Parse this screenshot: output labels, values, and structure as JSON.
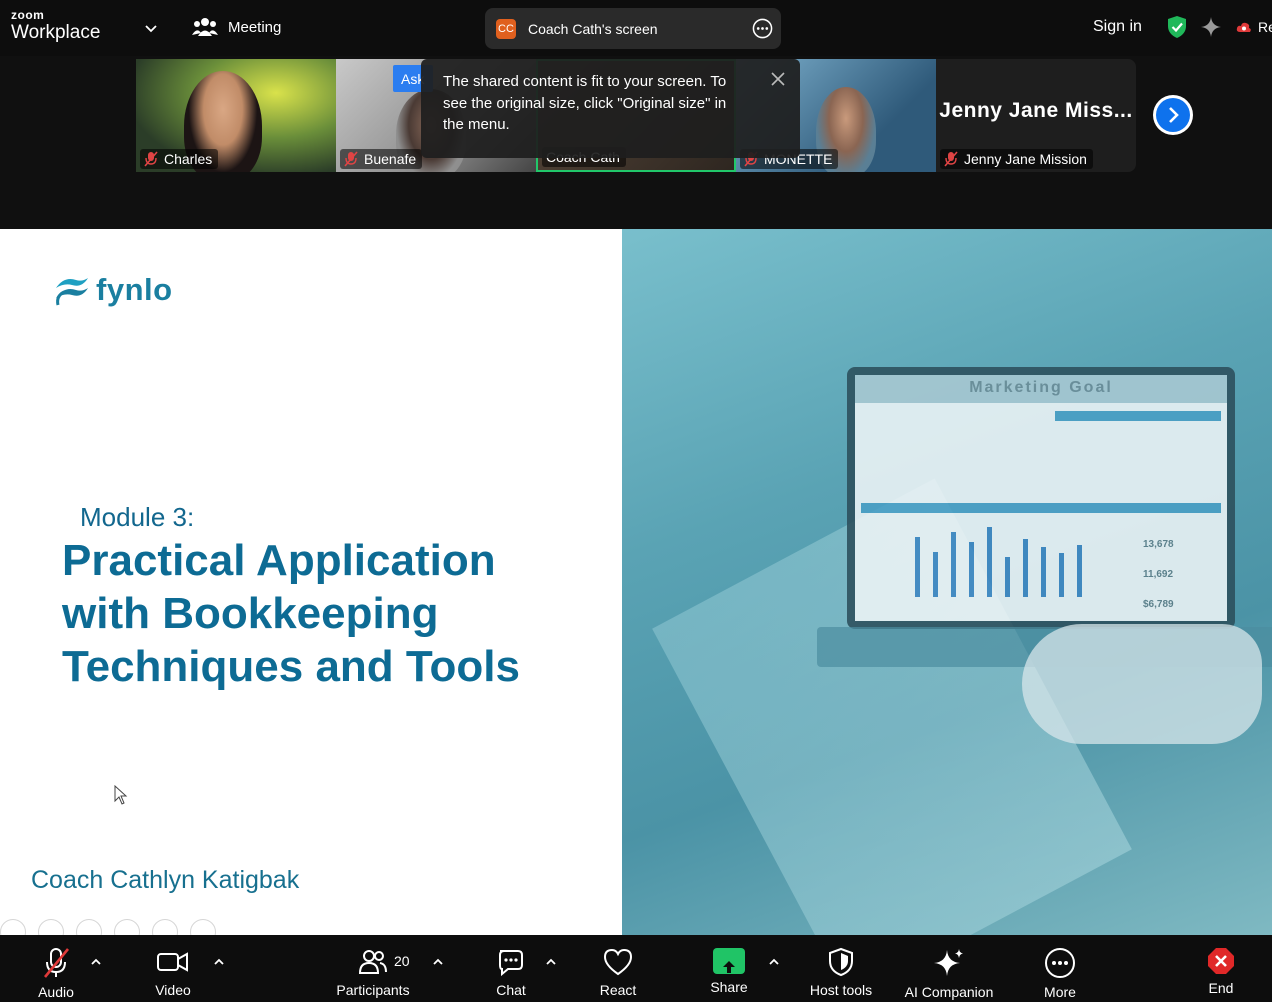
{
  "app": {
    "brand_top": "zoom",
    "brand_bottom": "Workplace",
    "meeting_label": "Meeting",
    "sign_in": "Sign in",
    "recording_label": "Re"
  },
  "share_pill": {
    "avatar_initials": "CC",
    "label": "Coach Cath's screen",
    "avatar_color": "#e0601e"
  },
  "gallery": {
    "tiles": [
      {
        "name": "Charles"
      },
      {
        "name": "Buenafe"
      },
      {
        "name": "Coach Cath"
      },
      {
        "name": "MONETTE"
      },
      {
        "name": "Jenny Jane Mission",
        "big_name": "Jenny Jane Miss..."
      }
    ],
    "ask_badge": "Ask",
    "active_speaker_color": "#21c76a"
  },
  "tooltip": {
    "text": "The shared content is fit to your screen. To see the original size, click \"Original size\" in the menu."
  },
  "slide": {
    "logo": "fynlo",
    "module": "Module 3:",
    "title_lines": [
      "Practical Application",
      "with Bookkeeping",
      "Techniques and Tools"
    ],
    "presenter": "Coach Cathlyn Katigbak",
    "image_title": "Marketing Goal",
    "image_kpis": [
      "13,678",
      "11,692",
      "$6,789"
    ],
    "title_color": "#0d6b94"
  },
  "toolbar": {
    "audio": "Audio",
    "video": "Video",
    "participants": "Participants",
    "participants_count": "20",
    "chat": "Chat",
    "react": "React",
    "share": "Share",
    "host_tools": "Host tools",
    "ai_companion": "AI Companion",
    "more": "More",
    "end": "End",
    "share_color": "#20c466",
    "end_color": "#e02828"
  }
}
